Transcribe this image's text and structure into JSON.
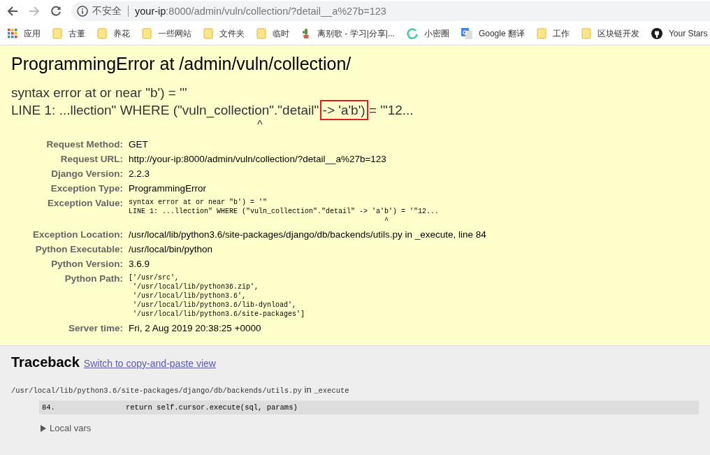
{
  "browser": {
    "security_label": "不安全",
    "url_host": "your-ip",
    "url_rest": ":8000/admin/vuln/collection/?detail__a%27b=123"
  },
  "bookmarks": [
    {
      "kind": "apps",
      "label": "应用"
    },
    {
      "kind": "folder",
      "label": "古董"
    },
    {
      "kind": "folder",
      "label": "养花"
    },
    {
      "kind": "folder",
      "label": "一些网站"
    },
    {
      "kind": "folder",
      "label": "文件夹"
    },
    {
      "kind": "folder",
      "label": "临时"
    },
    {
      "kind": "plant",
      "label": "离别歌 - 学习|分享|..."
    },
    {
      "kind": "ring",
      "label": "小密圈"
    },
    {
      "kind": "translate",
      "label": "Google 翻译"
    },
    {
      "kind": "folder",
      "label": "工作"
    },
    {
      "kind": "folder",
      "label": "区块链开发"
    },
    {
      "kind": "github",
      "label": "Your Stars"
    }
  ],
  "summary": {
    "title": "ProgrammingError at /admin/vuln/collection/",
    "exception_line_1": "syntax error at or near \"b') = '\"",
    "exception_line_2_before": "LINE 1: ...llection\" WHERE (\"vuln_collection\".\"detail\" ",
    "exception_line_2_highlighted": "-> 'a'b')",
    "exception_line_2_after": " = '\"12...",
    "caret": "^",
    "meta": [
      {
        "label": "Request Method:",
        "kind": "text",
        "lines": [
          "GET"
        ]
      },
      {
        "label": "Request URL:",
        "kind": "text",
        "lines": [
          "http://your-ip:8000/admin/vuln/collection/?detail__a%27b=123"
        ]
      },
      {
        "label": "Django Version:",
        "kind": "text",
        "lines": [
          "2.2.3"
        ]
      },
      {
        "label": "Exception Type:",
        "kind": "text",
        "lines": [
          "ProgrammingError"
        ]
      },
      {
        "label": "Exception Value:",
        "kind": "mono",
        "lines": [
          "syntax error at or near \"b') = '\"",
          "LINE 1: ...llection\" WHERE (\"vuln_collection\".\"detail\" -> 'a'b') = '\"12...",
          "                                                             ^"
        ]
      },
      {
        "label": "Exception Location:",
        "kind": "text",
        "lines": [
          "/usr/local/lib/python3.6/site-packages/django/db/backends/utils.py in _execute, line 84"
        ]
      },
      {
        "label": "Python Executable:",
        "kind": "text",
        "lines": [
          "/usr/local/bin/python"
        ]
      },
      {
        "label": "Python Version:",
        "kind": "text",
        "lines": [
          "3.6.9"
        ]
      },
      {
        "label": "Python Path:",
        "kind": "mono",
        "lines": [
          "['/usr/src',",
          " '/usr/local/lib/python36.zip',",
          " '/usr/local/lib/python3.6',",
          " '/usr/local/lib/python3.6/lib-dynload',",
          " '/usr/local/lib/python3.6/site-packages']"
        ]
      },
      {
        "label": "Server time:",
        "kind": "text",
        "lines": [
          "Fri, 2 Aug 2019 20:38:25 +0000"
        ]
      }
    ]
  },
  "traceback": {
    "title": "Traceback",
    "switch_link": "Switch to copy-and-paste view",
    "frame": {
      "file": "/usr/local/lib/python3.6/site-packages/django/db/backends/utils.py",
      "in_word": "in",
      "function": "_execute",
      "line_number": "84.",
      "code": "return self.cursor.execute(sql, params)",
      "local_vars": "Local vars",
      "local_vars_expanded": false
    }
  }
}
